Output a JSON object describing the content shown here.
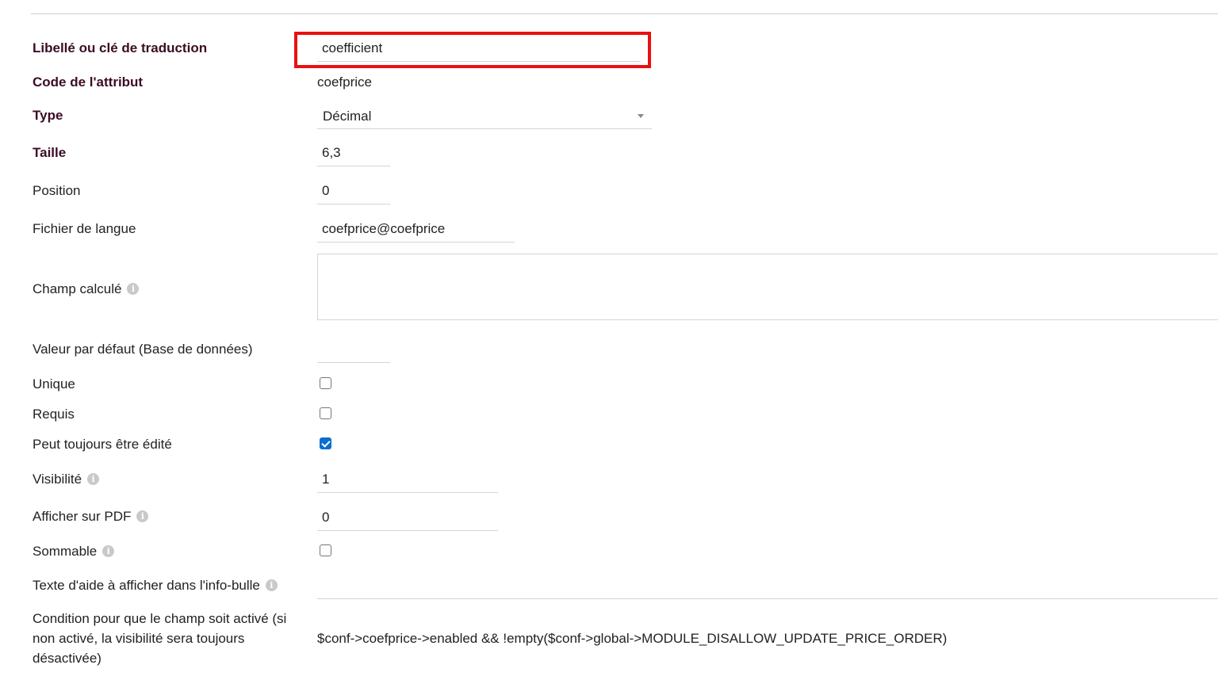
{
  "form": {
    "label_field": {
      "label": "Libellé ou clé de traduction",
      "value": "coefficient"
    },
    "attribute_code": {
      "label": "Code de l'attribut",
      "value": "coefprice"
    },
    "type": {
      "label": "Type",
      "selected": "Décimal"
    },
    "size": {
      "label": "Taille",
      "value": "6,3"
    },
    "position": {
      "label": "Position",
      "value": "0"
    },
    "language_file": {
      "label": "Fichier de langue",
      "value": "coefprice@coefprice"
    },
    "computed_field": {
      "label": "Champ calculé",
      "value": ""
    },
    "default_value": {
      "label": "Valeur par défaut (Base de données)",
      "value": ""
    },
    "unique": {
      "label": "Unique",
      "checked": false
    },
    "required": {
      "label": "Requis",
      "checked": false
    },
    "always_editable": {
      "label": "Peut toujours être édité",
      "checked": true
    },
    "visibility": {
      "label": "Visibilité",
      "value": "1"
    },
    "show_on_pdf": {
      "label": "Afficher sur PDF",
      "value": "0"
    },
    "summable": {
      "label": "Sommable",
      "checked": false
    },
    "help_text": {
      "label": "Texte d'aide à afficher dans l'info-bulle",
      "value": ""
    },
    "enabled_condition": {
      "label": "Condition pour que le champ soit activé (si non activé, la visibilité sera toujours désactivée)",
      "value": "$conf->coefprice->enabled && !empty($conf->global->MODULE_DISALLOW_UPDATE_PRICE_ORDER)"
    }
  },
  "icons": {
    "info": "info-icon",
    "info_glyph": "i"
  },
  "colors": {
    "highlight": "#ea1010",
    "required_label": "#3c0c24",
    "checkbox_checked": "#0a6ed1"
  }
}
